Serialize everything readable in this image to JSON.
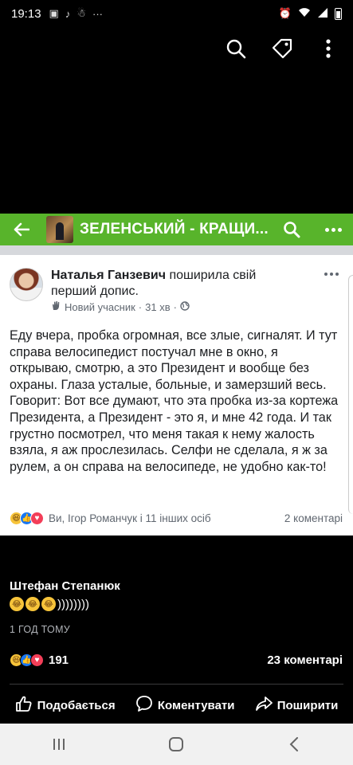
{
  "status_bar": {
    "time": "19:13",
    "more": "···"
  },
  "group_bar": {
    "title": "ЗЕЛЕНСЬКИЙ - КРАЩИ..."
  },
  "post": {
    "author": "Наталья Ганзевич",
    "action": " поширила свій перший допис.",
    "badge": "Новий учасник",
    "time": "31 хв",
    "text": "Еду вчера, пробка огромная, все злые, сигналят. И тут справа велосипедист постучал мне в окно, я открываю, смотрю, а это Президент и вообще без охраны. Глаза усталые, больные, и замерзший весь. Говорит: Вот все думают, что эта пробка из-за кортежа Президента, а Президент - это я, и мне 42 года. И так грустно посмотрел, что меня такая к нему жалость взяла, я аж прослезилась. Селфи не сделала, я ж за рулем, а он справа на велосипеде, не удобно как-то!",
    "reactors": "Ви, Ігор Романчук і 11 інших осіб",
    "comments": "2 коментарі"
  },
  "comment": {
    "author": "Штефан Степанюк",
    "text": "))))))))",
    "time": "1 ГОД ТОМУ"
  },
  "stats": {
    "reactions": "191",
    "comments": "23 коментарі"
  },
  "actions": {
    "like": "Подобається",
    "comment": "Коментувати",
    "share": "Поширити"
  },
  "colors": {
    "group_green": "#58b42b",
    "like_blue": "#1877f2",
    "love_red": "#f33e58",
    "haha_yellow": "#f7c43a"
  }
}
